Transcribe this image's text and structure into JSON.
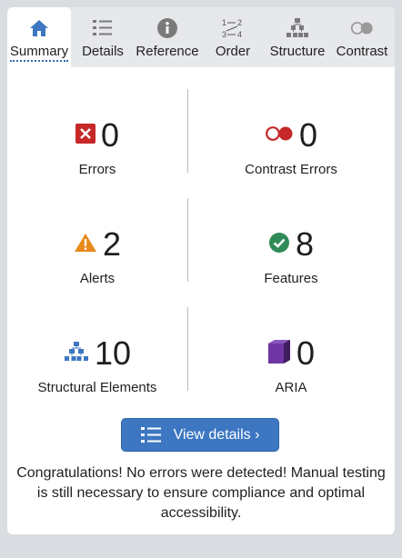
{
  "tabs": [
    {
      "label": "Summary",
      "icon": "home-icon",
      "active": true
    },
    {
      "label": "Details",
      "icon": "list-icon"
    },
    {
      "label": "Reference",
      "icon": "info-icon"
    },
    {
      "label": "Order",
      "icon": "order-icon"
    },
    {
      "label": "Structure",
      "icon": "structure-icon"
    },
    {
      "label": "Contrast",
      "icon": "contrast-icon"
    }
  ],
  "summary": {
    "errors": {
      "count": "0",
      "label": "Errors",
      "color": "#c62828"
    },
    "contrast_errors": {
      "count": "0",
      "label": "Contrast Errors",
      "color": "#c62828"
    },
    "alerts": {
      "count": "2",
      "label": "Alerts",
      "color": "#e8891b"
    },
    "features": {
      "count": "8",
      "label": "Features",
      "color": "#2e8b57"
    },
    "structural": {
      "count": "10",
      "label": "Structural Elements",
      "color": "#3d77c2"
    },
    "aria": {
      "count": "0",
      "label": "ARIA",
      "color": "#5b2a86"
    }
  },
  "actions": {
    "view_details_label": "View details ›"
  },
  "message": "Congratulations! No errors were detected! Manual testing is still necessary to ensure compliance and optimal accessibility."
}
